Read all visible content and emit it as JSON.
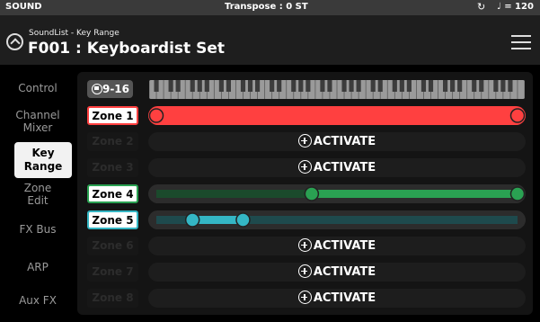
{
  "status_bar": {
    "mode": "SOUND",
    "transpose": "Transpose : 0 ST",
    "tempo": "♩ = 120",
    "sync_icon": "↻"
  },
  "header": {
    "breadcrumb": "SoundList - Key Range",
    "title": "F001 : Keyboardist Set"
  },
  "sidebar": {
    "items": [
      {
        "label": "Control",
        "active": false
      },
      {
        "label": "Channel Mixer",
        "active": false
      },
      {
        "label": "Key Range",
        "active": true
      },
      {
        "label": "Zone Edit",
        "active": false
      },
      {
        "label": "FX Bus",
        "active": false
      },
      {
        "label": "ARP",
        "active": false
      },
      {
        "label": "Aux FX",
        "active": false
      }
    ]
  },
  "range_button": {
    "label": "9-16"
  },
  "zones": [
    {
      "label": "Zone 1",
      "active": true,
      "color": "#ff4040",
      "bar_color": "#ff4040",
      "low_frac": 0.0,
      "high_frac": 1.0
    },
    {
      "label": "Zone 2",
      "active": false,
      "action_label": "ACTIVATE"
    },
    {
      "label": "Zone 3",
      "active": false,
      "action_label": "ACTIVATE"
    },
    {
      "label": "Zone 4",
      "active": true,
      "color": "#2aa152",
      "bar_color": "#2aa152",
      "dim_color": "#1b4a2c",
      "low_frac": 0.43,
      "high_frac": 1.0
    },
    {
      "label": "Zone 5",
      "active": true,
      "color": "#34b6c4",
      "bar_color": "#34b6c4",
      "dim_color": "#1e4a4d",
      "low_frac": 0.1,
      "high_frac": 0.24
    },
    {
      "label": "Zone 6",
      "active": false,
      "action_label": "ACTIVATE"
    },
    {
      "label": "Zone 7",
      "active": false,
      "action_label": "ACTIVATE"
    },
    {
      "label": "Zone 8",
      "active": false,
      "action_label": "ACTIVATE"
    }
  ]
}
